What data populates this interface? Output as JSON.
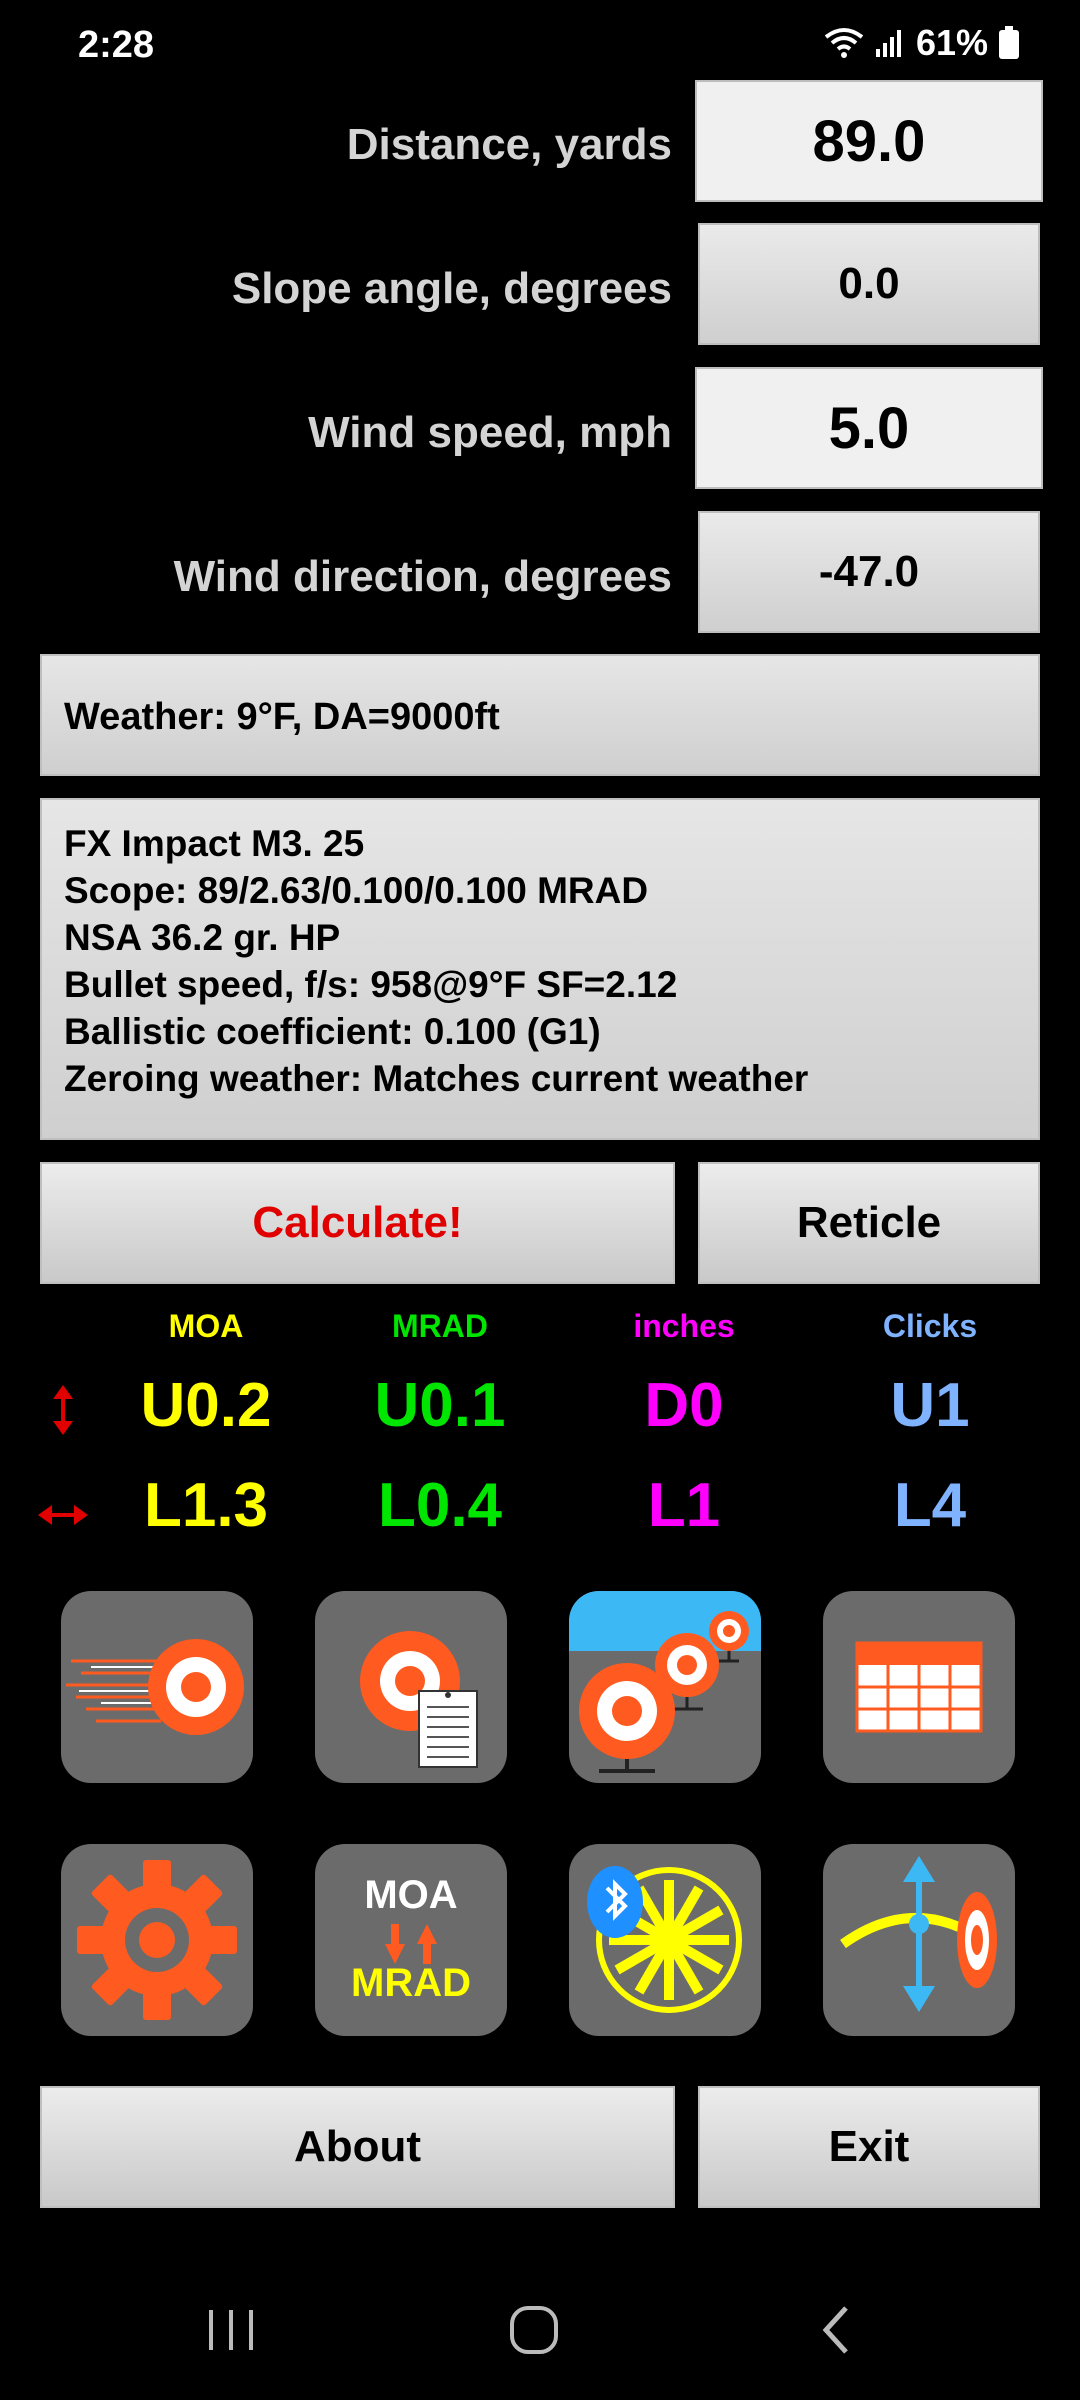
{
  "status": {
    "time": "2:28",
    "battery": "61%"
  },
  "inputs": {
    "distance": {
      "label": "Distance, yards",
      "value": "89.0"
    },
    "slope": {
      "label": "Slope angle, degrees",
      "value": "0.0"
    },
    "wind_speed": {
      "label": "Wind speed, mph",
      "value": "5.0"
    },
    "wind_direction": {
      "label": "Wind direction, degrees",
      "value": "-47.0"
    }
  },
  "weather": "Weather: 9°F, DA=9000ft",
  "profile": {
    "line1": "FX Impact M3. 25",
    "line2": "Scope: 89/2.63/0.100/0.100 MRAD",
    "line3": "NSA 36.2 gr. HP",
    "line4": "Bullet speed, f/s: 958@9°F SF=2.12",
    "line5": "Ballistic coefficient: 0.100 (G1)",
    "line6": "Zeroing weather: Matches current weather"
  },
  "buttons": {
    "calculate": "Calculate!",
    "reticle": "Reticle",
    "about": "About",
    "exit": "Exit"
  },
  "results": {
    "headers": {
      "moa": "MOA",
      "mrad": "MRAD",
      "inches": "inches",
      "clicks": "Clicks"
    },
    "vertical": {
      "moa": "U0.2",
      "mrad": "U0.1",
      "inches": "D0",
      "clicks": "U1"
    },
    "horizontal": {
      "moa": "L1.3",
      "mrad": "L0.4",
      "inches": "L1",
      "clicks": "L4"
    }
  },
  "tiles": {
    "converter_top": "MOA",
    "converter_bottom": "MRAD"
  },
  "colors": {
    "moa": "#ffff00",
    "mrad": "#00e600",
    "inches": "#ff00ff",
    "clicks": "#7fb2ff",
    "calculate": "#e00000",
    "tile_bg": "#6b6b6b",
    "target_orange": "#ff5a1f"
  },
  "icons": [
    "up-down-arrow-icon",
    "left-right-arrow-icon",
    "speed-target-icon",
    "target-report-icon",
    "multi-target-icon",
    "table-icon",
    "gear-icon",
    "moa-mrad-converter-icon",
    "bluetooth-wind-meter-icon",
    "trajectory-icon",
    "recent-apps-icon",
    "home-icon",
    "back-icon"
  ]
}
